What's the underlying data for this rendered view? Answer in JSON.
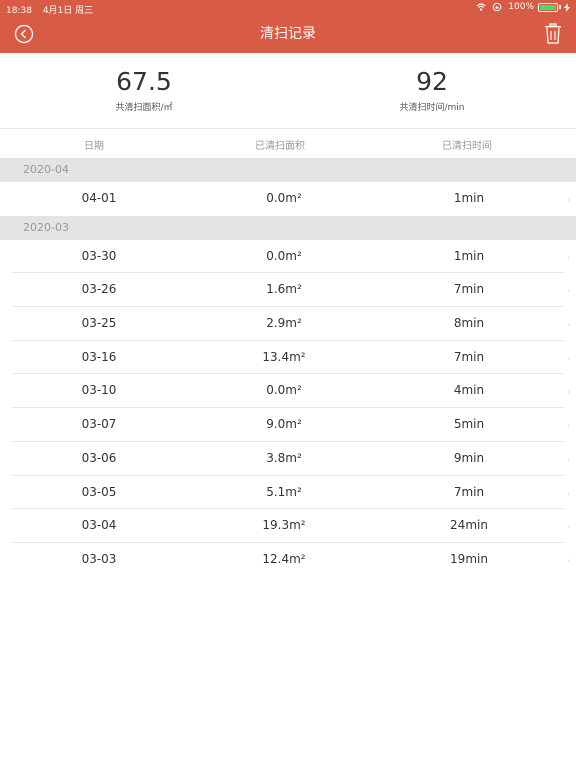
{
  "status_bar": {
    "time": "18:38",
    "date": "4月1日 周三",
    "battery": "100%"
  },
  "header": {
    "title": "清扫记录"
  },
  "summary": {
    "area_value": "67.5",
    "area_label": "共清扫面积/㎡",
    "time_value": "92",
    "time_label": "共清扫时间/min"
  },
  "columns": {
    "date": "日期",
    "area": "已清扫面积",
    "time": "已清扫时间"
  },
  "sections": [
    {
      "title": "2020-04",
      "rows": [
        {
          "date": "04-01",
          "area": "0.0m²",
          "time": "1min"
        }
      ]
    },
    {
      "title": "2020-03",
      "rows": [
        {
          "date": "03-30",
          "area": "0.0m²",
          "time": "1min"
        },
        {
          "date": "03-26",
          "area": "1.6m²",
          "time": "7min"
        },
        {
          "date": "03-25",
          "area": "2.9m²",
          "time": "8min"
        },
        {
          "date": "03-16",
          "area": "13.4m²",
          "time": "7min"
        },
        {
          "date": "03-10",
          "area": "0.0m²",
          "time": "4min"
        },
        {
          "date": "03-07",
          "area": "9.0m²",
          "time": "5min"
        },
        {
          "date": "03-06",
          "area": "3.8m²",
          "time": "9min"
        },
        {
          "date": "03-05",
          "area": "5.1m²",
          "time": "7min"
        },
        {
          "date": "03-04",
          "area": "19.3m²",
          "time": "24min"
        },
        {
          "date": "03-03",
          "area": "12.4m²",
          "time": "19min"
        }
      ]
    }
  ],
  "colors": {
    "header_bg": "#d85b45",
    "section_bg": "#e4e4e6",
    "battery": "#4cd964"
  },
  "icons": {
    "back": "chevron-left-circle-icon",
    "delete": "trash-icon",
    "row": "chevron-right-icon"
  }
}
